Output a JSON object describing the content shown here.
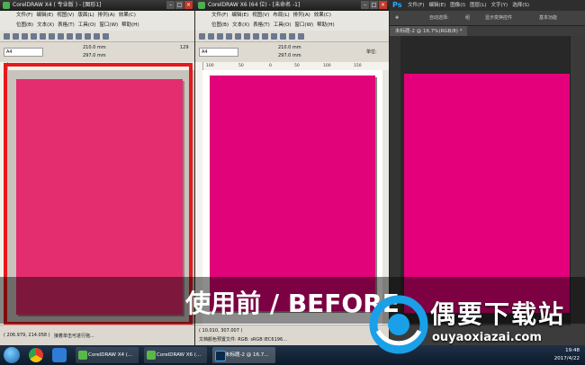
{
  "colors": {
    "x4_page": "#e42d6e",
    "x6_page": "#e0037a",
    "ps_page": "#e4007a",
    "highlight": "#e8191c",
    "ps_accent": "#31a8ff"
  },
  "x4": {
    "title": "CorelDRAW X4 ( 专业版 ) - [图形1]",
    "menu": [
      "文件(F)",
      "编辑(E)",
      "视图(V)",
      "版面(L)",
      "排列(A)",
      "效果(C)"
    ],
    "menu2": [
      "位图(B)",
      "文本(X)",
      "表格(T)",
      "工具(O)",
      "窗口(W)",
      "帮助(H)"
    ],
    "page_size": "A4",
    "width": "210.0 mm",
    "height": "297.0 mm",
    "zoom": "129",
    "status_coords": "( 206.979, 214.058 )",
    "status_hint": "接着单击可进行拖..."
  },
  "x6": {
    "title": "CorelDRAW X6 (64 位) - [未命名 -1]",
    "menu": [
      "文件(F)",
      "编辑(E)",
      "视图(V)",
      "布局(L)",
      "排列(A)",
      "效果(C)"
    ],
    "menu2": [
      "位图(B)",
      "文本(X)",
      "表格(T)",
      "工具(O)",
      "窗口(W)",
      "帮助(H)"
    ],
    "page_size": "A4",
    "width": "210.0 mm",
    "height": "297.0 mm",
    "units": "单位:",
    "ruler_ticks": [
      "100",
      "50",
      "0",
      "50",
      "100",
      "150"
    ],
    "status_coords": "( 10.010, 307.007 )",
    "status_color": "文档颜色预置文件: RGB: sRGB IEC6196..."
  },
  "ps": {
    "logo": "Ps",
    "menu": [
      "文件(F)",
      "编辑(E)",
      "图像(I)",
      "图层(L)",
      "文字(Y)",
      "选择(S)"
    ],
    "auto_select": "自动选择:",
    "group": "组",
    "show_transform": "显示变换控件",
    "workspace": "基本功能",
    "doc_tab": "未标题-2 @ 16.7%(RGB/8) *"
  },
  "taskbar": {
    "items": [
      "CorelDRAW X4 (...",
      "CorelDRAW X6 (...",
      "未标题-2 @ 16.7..."
    ],
    "time": "19:48",
    "date": "2017/4/22"
  },
  "banner": {
    "text": "使用前 / BEFORE"
  },
  "watermark": {
    "name": "偶要下载站",
    "url": "ouyaoxiazai.com"
  }
}
